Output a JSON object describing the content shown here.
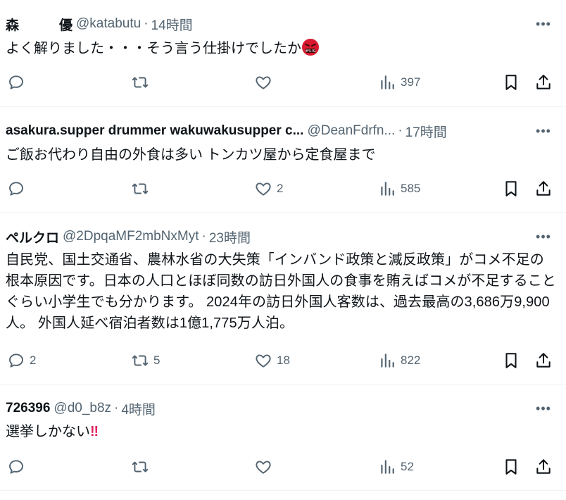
{
  "tweets": [
    {
      "name": "森　　　優",
      "handle": "@katabutu",
      "time": "14時間",
      "text": "よく解りました・・・そう言う仕掛けでしたか",
      "emoji": "angry-face-icon",
      "replies": "",
      "retweets": "",
      "likes": "",
      "views": "397"
    },
    {
      "name": "asakura.supper drummer wakuwakusupper c...",
      "handle": "@DeanFdrfn...",
      "time": "17時間",
      "text": "ご飯お代わり自由の外食は多い トンカツ屋から定食屋まで",
      "replies": "",
      "retweets": "",
      "likes": "2",
      "views": "585"
    },
    {
      "name": "ペルクロ",
      "handle": "@2DpqaMF2mbNxMyt",
      "time": "23時間",
      "text": "自民党、国土交通省、農林水省の大失策「インバンド政策と減反政策」がコメ不足の根本原因です。日本の人口とほぼ同数の訪日外国人の食事を賄えばコメが不足することぐらい小学生でも分かります。 2024年の訪日外国人客数は、過去最高の3,686万9,900人。 外国人延べ宿泊者数は1億1,775万人泊。",
      "replies": "2",
      "retweets": "5",
      "likes": "18",
      "views": "822"
    },
    {
      "name": "726396",
      "handle": "@d0_b8z",
      "time": "4時間",
      "text": "選挙しかない",
      "text_suffix": "‼",
      "replies": "",
      "retweets": "",
      "likes": "",
      "views": "52"
    }
  ],
  "colors": {
    "text": "#0f1419",
    "muted": "#536471",
    "divider": "#eff3f4",
    "exclaim": "#e0245e"
  }
}
